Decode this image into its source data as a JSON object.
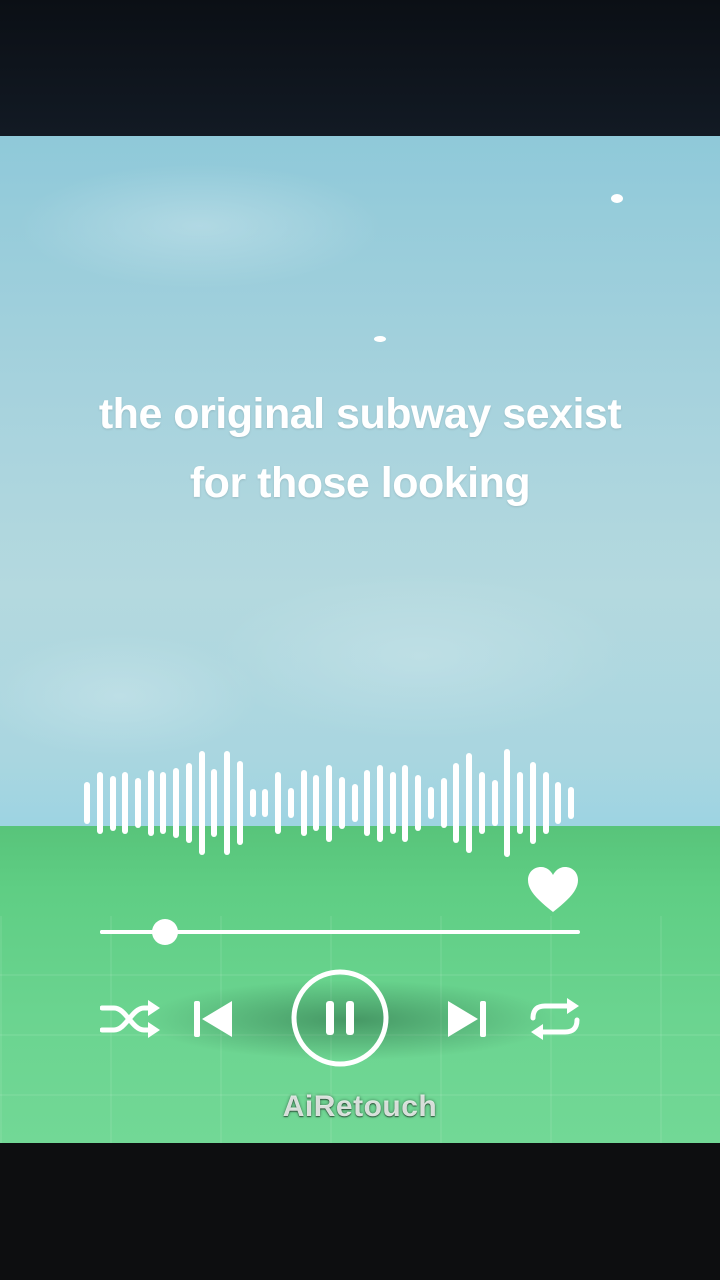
{
  "caption": {
    "line1": "the original subway sexist",
    "line2": "for those looking"
  },
  "player": {
    "progress_fraction": 0.135,
    "liked": true,
    "state": "playing",
    "controls": {
      "shuffle": "shuffle-icon",
      "previous": "skip-previous-icon",
      "play_pause": "pause-icon",
      "next": "skip-next-icon",
      "repeat": "repeat-icon",
      "like": "heart-icon"
    },
    "waveform_levels": [
      0.38,
      0.56,
      0.5,
      0.56,
      0.45,
      0.6,
      0.56,
      0.64,
      0.73,
      0.95,
      0.62,
      0.95,
      0.77,
      0.25,
      0.25,
      0.56,
      0.27,
      0.6,
      0.51,
      0.7,
      0.47,
      0.35,
      0.6,
      0.7,
      0.56,
      0.7,
      0.51,
      0.29,
      0.45,
      0.73,
      0.91,
      0.56,
      0.42,
      0.98,
      0.56,
      0.75,
      0.56,
      0.38,
      0.29
    ]
  },
  "colors": {
    "sky": "#a6d2dd",
    "ground": "#62cf86",
    "foreground": "#ffffff"
  },
  "watermark": "AiRetouch"
}
